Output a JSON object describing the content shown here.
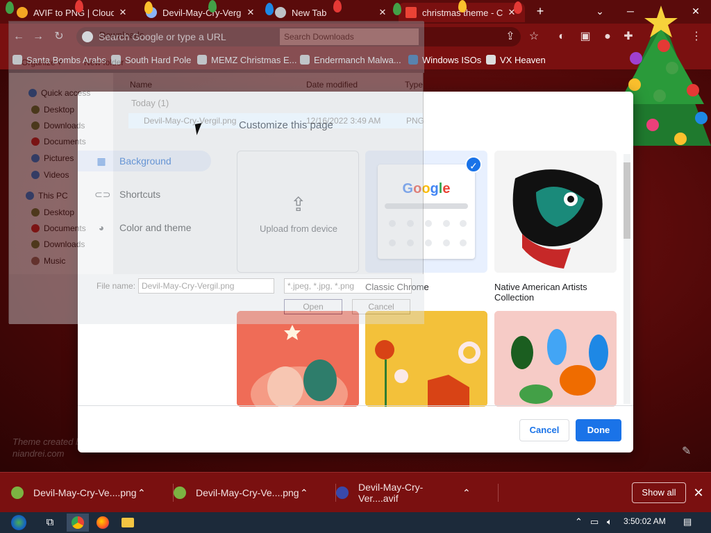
{
  "browser": {
    "tabs": [
      {
        "label": "AVIF to PNG | CloudCo",
        "favicon_color": "#f5a623",
        "active": false
      },
      {
        "label": "Devil-May-Cry-Vergil",
        "favicon_color": "#8ab4f8",
        "active": false
      },
      {
        "label": "New Tab",
        "favicon_color": "#bdc1c6",
        "active": false
      },
      {
        "label": "christmas theme - Chr",
        "favicon_color": "#ea4335",
        "active": true
      }
    ],
    "new_tab_symbol": "+",
    "window_controls": {
      "minimize": "─",
      "maximize": "☐",
      "close": "✕"
    },
    "omnibox_placeholder": "Search Google or type a URL",
    "bookmarks": [
      {
        "label": "Santa Bombs Arabs"
      },
      {
        "label": "South Hard Pole"
      },
      {
        "label": "MEMZ Christmas E..."
      },
      {
        "label": "Endermanch Malwa..."
      },
      {
        "label": "Windows ISOs"
      },
      {
        "label": "VX Heaven"
      }
    ]
  },
  "page": {
    "credit_line1": "Theme created by",
    "credit_line2": "niandrei.com"
  },
  "customize_dialog": {
    "title": "Customize this page",
    "nav": [
      {
        "label": "Background",
        "icon": "image-icon",
        "selected": true
      },
      {
        "label": "Shortcuts",
        "icon": "link-icon",
        "selected": false
      },
      {
        "label": "Color and theme",
        "icon": "palette-icon",
        "selected": false
      }
    ],
    "tiles": {
      "upload_label": "Upload from device",
      "classic_label": "Classic Chrome",
      "classic_logo": "Google",
      "native_label": "Native American Artists Collection"
    },
    "cancel_label": "Cancel",
    "done_label": "Done",
    "accent_color": "#1a73e8"
  },
  "file_explorer": {
    "path": "Downloads",
    "search_placeholder": "Search Downloads",
    "organize_label": "Organize ▾",
    "new_folder_label": "New folder",
    "nav": {
      "quick_access": "Quick access",
      "quick_items": [
        "Desktop",
        "Downloads",
        "Documents",
        "Pictures",
        "Videos"
      ],
      "this_pc": "This PC",
      "pc_items": [
        "Desktop",
        "Documents",
        "Downloads",
        "Music"
      ]
    },
    "columns": {
      "name": "Name",
      "date": "Date modified",
      "type": "Type"
    },
    "group": "Today (1)",
    "file": {
      "name": "Devil-May-Cry-Vergil.png",
      "date": "12/16/2022 3:49 AM",
      "type": "PNG"
    },
    "file_name_label": "File name:",
    "file_name_value": "Devil-May-Cry-Vergil.png",
    "filter_value": "*.jpeg, *.jpg, *.png",
    "open_label": "Open",
    "cancel_label": "Cancel"
  },
  "downloads_bar": {
    "items": [
      {
        "name": "Devil-May-Cry-Ve....png",
        "icon_color": "#7cb342"
      },
      {
        "name": "Devil-May-Cry-Ve....png",
        "icon_color": "#7cb342"
      },
      {
        "name": "Devil-May-Cry-Ver....avif",
        "icon_color": "#3949ab"
      }
    ],
    "show_all_label": "Show all",
    "close_symbol": "✕"
  },
  "taskbar": {
    "clock": "3:50:02 AM"
  }
}
